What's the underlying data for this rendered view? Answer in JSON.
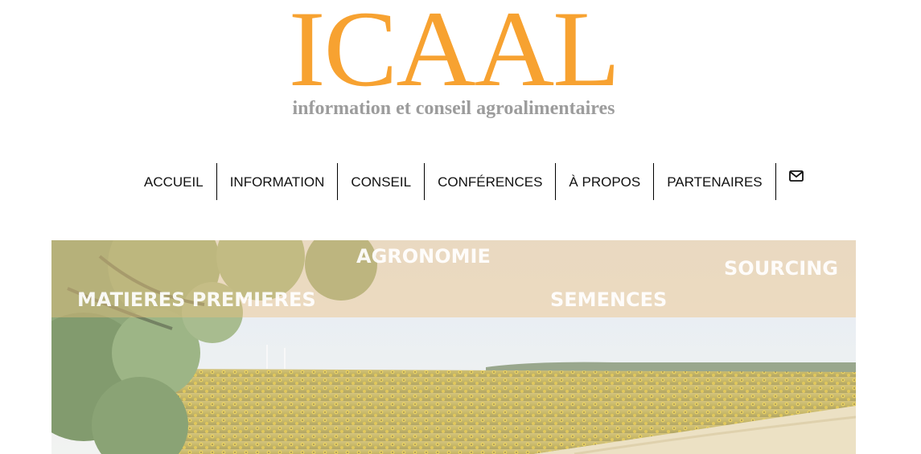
{
  "logo": {
    "name": "ICAAL",
    "tagline": "information et conseil agroalimentaires",
    "color": "#f7a231",
    "tagline_color": "#9c9c9c"
  },
  "nav": {
    "items": [
      {
        "label": "ACCUEIL"
      },
      {
        "label": "INFORMATION"
      },
      {
        "label": "CONSEIL"
      },
      {
        "label": "CONFÉRENCES"
      },
      {
        "label": "À PROPOS"
      },
      {
        "label": "PARTENAIRES"
      }
    ],
    "contact_icon": "mail-icon"
  },
  "hero": {
    "keywords": [
      "AGRONOMIE",
      "SOURCING",
      "MATIERES PREMIERES",
      "SEMENCES"
    ],
    "scene": "sunflower-field-with-walnut-tree",
    "overlay_color": "#eebe7a"
  }
}
